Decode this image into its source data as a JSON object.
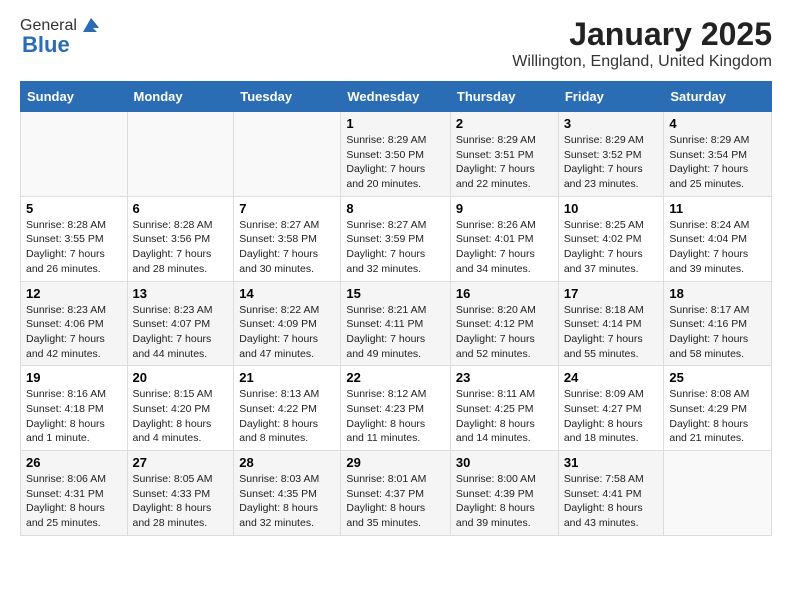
{
  "logo": {
    "general": "General",
    "blue": "Blue"
  },
  "title": "January 2025",
  "subtitle": "Willington, England, United Kingdom",
  "days": [
    "Sunday",
    "Monday",
    "Tuesday",
    "Wednesday",
    "Thursday",
    "Friday",
    "Saturday"
  ],
  "weeks": [
    [
      {
        "day": "",
        "content": ""
      },
      {
        "day": "",
        "content": ""
      },
      {
        "day": "",
        "content": ""
      },
      {
        "day": "1",
        "content": "Sunrise: 8:29 AM\nSunset: 3:50 PM\nDaylight: 7 hours\nand 20 minutes."
      },
      {
        "day": "2",
        "content": "Sunrise: 8:29 AM\nSunset: 3:51 PM\nDaylight: 7 hours\nand 22 minutes."
      },
      {
        "day": "3",
        "content": "Sunrise: 8:29 AM\nSunset: 3:52 PM\nDaylight: 7 hours\nand 23 minutes."
      },
      {
        "day": "4",
        "content": "Sunrise: 8:29 AM\nSunset: 3:54 PM\nDaylight: 7 hours\nand 25 minutes."
      }
    ],
    [
      {
        "day": "5",
        "content": "Sunrise: 8:28 AM\nSunset: 3:55 PM\nDaylight: 7 hours\nand 26 minutes."
      },
      {
        "day": "6",
        "content": "Sunrise: 8:28 AM\nSunset: 3:56 PM\nDaylight: 7 hours\nand 28 minutes."
      },
      {
        "day": "7",
        "content": "Sunrise: 8:27 AM\nSunset: 3:58 PM\nDaylight: 7 hours\nand 30 minutes."
      },
      {
        "day": "8",
        "content": "Sunrise: 8:27 AM\nSunset: 3:59 PM\nDaylight: 7 hours\nand 32 minutes."
      },
      {
        "day": "9",
        "content": "Sunrise: 8:26 AM\nSunset: 4:01 PM\nDaylight: 7 hours\nand 34 minutes."
      },
      {
        "day": "10",
        "content": "Sunrise: 8:25 AM\nSunset: 4:02 PM\nDaylight: 7 hours\nand 37 minutes."
      },
      {
        "day": "11",
        "content": "Sunrise: 8:24 AM\nSunset: 4:04 PM\nDaylight: 7 hours\nand 39 minutes."
      }
    ],
    [
      {
        "day": "12",
        "content": "Sunrise: 8:23 AM\nSunset: 4:06 PM\nDaylight: 7 hours\nand 42 minutes."
      },
      {
        "day": "13",
        "content": "Sunrise: 8:23 AM\nSunset: 4:07 PM\nDaylight: 7 hours\nand 44 minutes."
      },
      {
        "day": "14",
        "content": "Sunrise: 8:22 AM\nSunset: 4:09 PM\nDaylight: 7 hours\nand 47 minutes."
      },
      {
        "day": "15",
        "content": "Sunrise: 8:21 AM\nSunset: 4:11 PM\nDaylight: 7 hours\nand 49 minutes."
      },
      {
        "day": "16",
        "content": "Sunrise: 8:20 AM\nSunset: 4:12 PM\nDaylight: 7 hours\nand 52 minutes."
      },
      {
        "day": "17",
        "content": "Sunrise: 8:18 AM\nSunset: 4:14 PM\nDaylight: 7 hours\nand 55 minutes."
      },
      {
        "day": "18",
        "content": "Sunrise: 8:17 AM\nSunset: 4:16 PM\nDaylight: 7 hours\nand 58 minutes."
      }
    ],
    [
      {
        "day": "19",
        "content": "Sunrise: 8:16 AM\nSunset: 4:18 PM\nDaylight: 8 hours\nand 1 minute."
      },
      {
        "day": "20",
        "content": "Sunrise: 8:15 AM\nSunset: 4:20 PM\nDaylight: 8 hours\nand 4 minutes."
      },
      {
        "day": "21",
        "content": "Sunrise: 8:13 AM\nSunset: 4:22 PM\nDaylight: 8 hours\nand 8 minutes."
      },
      {
        "day": "22",
        "content": "Sunrise: 8:12 AM\nSunset: 4:23 PM\nDaylight: 8 hours\nand 11 minutes."
      },
      {
        "day": "23",
        "content": "Sunrise: 8:11 AM\nSunset: 4:25 PM\nDaylight: 8 hours\nand 14 minutes."
      },
      {
        "day": "24",
        "content": "Sunrise: 8:09 AM\nSunset: 4:27 PM\nDaylight: 8 hours\nand 18 minutes."
      },
      {
        "day": "25",
        "content": "Sunrise: 8:08 AM\nSunset: 4:29 PM\nDaylight: 8 hours\nand 21 minutes."
      }
    ],
    [
      {
        "day": "26",
        "content": "Sunrise: 8:06 AM\nSunset: 4:31 PM\nDaylight: 8 hours\nand 25 minutes."
      },
      {
        "day": "27",
        "content": "Sunrise: 8:05 AM\nSunset: 4:33 PM\nDaylight: 8 hours\nand 28 minutes."
      },
      {
        "day": "28",
        "content": "Sunrise: 8:03 AM\nSunset: 4:35 PM\nDaylight: 8 hours\nand 32 minutes."
      },
      {
        "day": "29",
        "content": "Sunrise: 8:01 AM\nSunset: 4:37 PM\nDaylight: 8 hours\nand 35 minutes."
      },
      {
        "day": "30",
        "content": "Sunrise: 8:00 AM\nSunset: 4:39 PM\nDaylight: 8 hours\nand 39 minutes."
      },
      {
        "day": "31",
        "content": "Sunrise: 7:58 AM\nSunset: 4:41 PM\nDaylight: 8 hours\nand 43 minutes."
      },
      {
        "day": "",
        "content": ""
      }
    ]
  ]
}
